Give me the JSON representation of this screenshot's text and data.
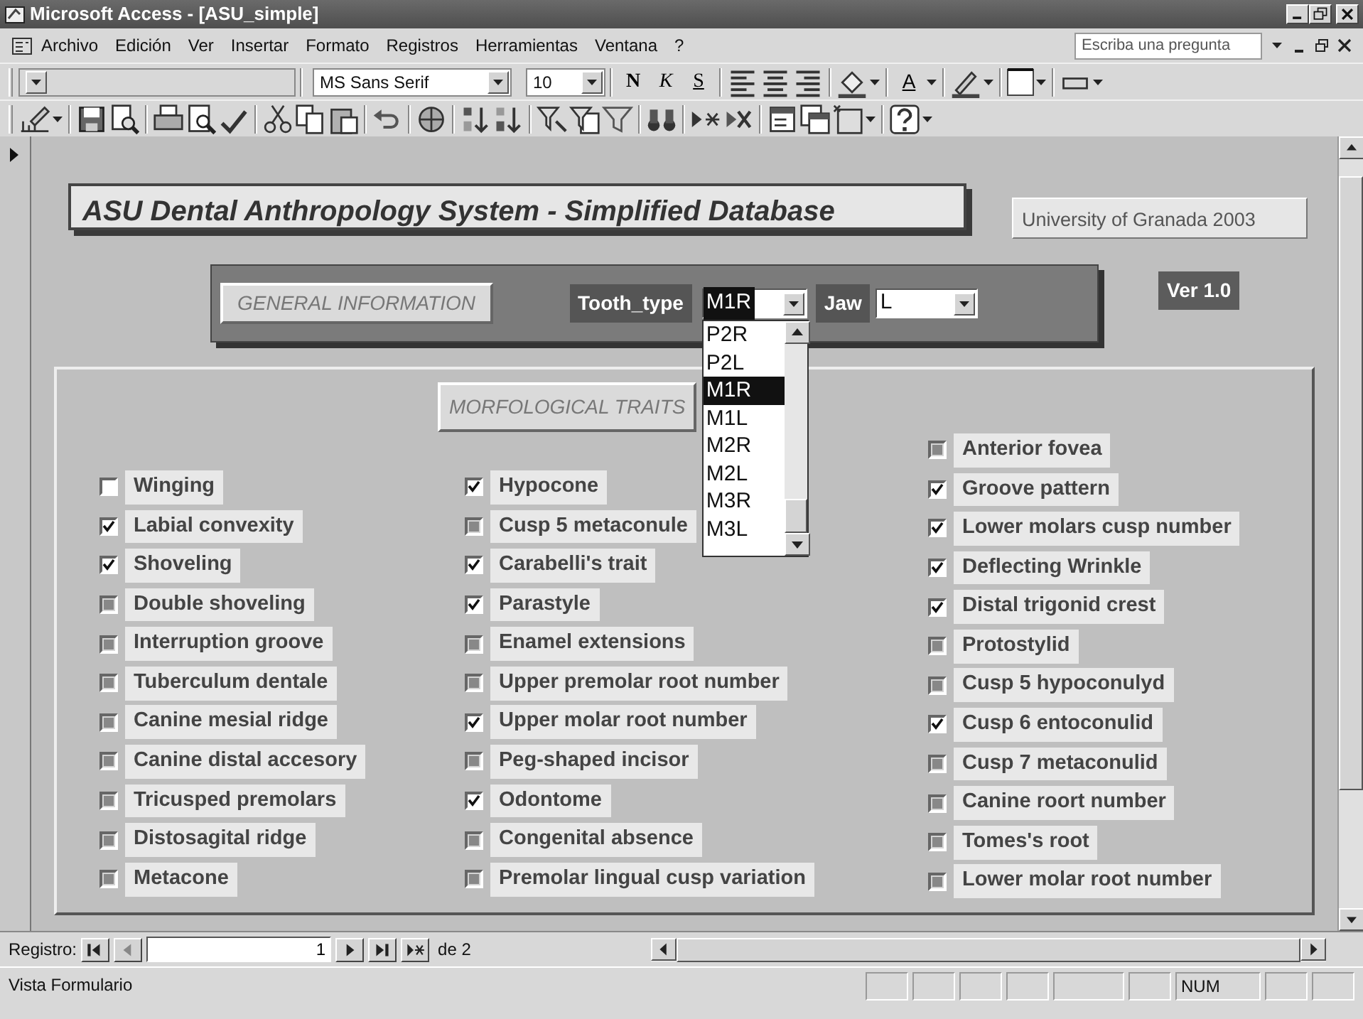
{
  "window": {
    "title": "Microsoft Access - [ASU_simple]"
  },
  "menu_bar": {
    "items": [
      "Archivo",
      "Edición",
      "Ver",
      "Insertar",
      "Formato",
      "Registros",
      "Herramientas",
      "Ventana",
      "?"
    ],
    "help_box": {
      "placeholder": "Escriba una pregunta"
    }
  },
  "format_toolbar": {
    "font": "MS Sans Serif",
    "size": "10",
    "style_buttons": [
      "N",
      "K",
      "S"
    ],
    "font_color_button": "A"
  },
  "form": {
    "title": "ASU Dental Anthropology System - Simplified Database",
    "credit": "University of Granada  2003",
    "general_panel": {
      "button": "GENERAL INFORMATION",
      "tooth_type": {
        "label": "Tooth_type",
        "value": "M1R",
        "expanded": true
      },
      "jaw": {
        "label": "Jaw",
        "value": "L"
      }
    },
    "version": "Ver 1.0",
    "tooth_list": [
      {
        "label": "P2R",
        "selected": false
      },
      {
        "label": "P2L",
        "selected": false
      },
      {
        "label": "M1R",
        "selected": true
      },
      {
        "label": "M1L",
        "selected": false
      },
      {
        "label": "M2R",
        "selected": false
      },
      {
        "label": "M2L",
        "selected": false
      },
      {
        "label": "M3R",
        "selected": false
      },
      {
        "label": "M3L",
        "selected": false
      }
    ],
    "traits": {
      "title": "MORFOLOGICAL TRAITS",
      "columns": [
        {
          "items": [
            {
              "label": "Winging",
              "checked": false,
              "greyed": false
            },
            {
              "label": "Labial convexity",
              "checked": true,
              "greyed": false
            },
            {
              "label": "Shoveling",
              "checked": true,
              "greyed": false
            },
            {
              "label": "Double shoveling",
              "checked": false,
              "greyed": true
            },
            {
              "label": "Interruption groove",
              "checked": false,
              "greyed": true
            },
            {
              "label": "Tuberculum dentale",
              "checked": false,
              "greyed": true
            },
            {
              "label": "Canine mesial ridge",
              "checked": false,
              "greyed": true
            },
            {
              "label": "Canine distal accesory",
              "checked": false,
              "greyed": true
            },
            {
              "label": "Tricusped premolars",
              "checked": false,
              "greyed": true
            },
            {
              "label": "Distosagital ridge",
              "checked": false,
              "greyed": true
            },
            {
              "label": "Metacone",
              "checked": false,
              "greyed": true
            }
          ]
        },
        {
          "items": [
            {
              "label": "Hypocone",
              "checked": true,
              "greyed": false
            },
            {
              "label": "Cusp 5 metaconule",
              "checked": false,
              "greyed": true
            },
            {
              "label": "Carabelli's trait",
              "checked": true,
              "greyed": false
            },
            {
              "label": "Parastyle",
              "checked": true,
              "greyed": false
            },
            {
              "label": "Enamel extensions",
              "checked": false,
              "greyed": true
            },
            {
              "label": "Upper premolar root number",
              "checked": false,
              "greyed": true
            },
            {
              "label": "Upper molar root number",
              "checked": true,
              "greyed": false
            },
            {
              "label": "Peg-shaped incisor",
              "checked": false,
              "greyed": true
            },
            {
              "label": "Odontome",
              "checked": true,
              "greyed": false
            },
            {
              "label": "Congenital absence",
              "checked": false,
              "greyed": true
            },
            {
              "label": "Premolar lingual cusp variation",
              "checked": false,
              "greyed": true
            }
          ]
        },
        {
          "items": [
            {
              "label": "Anterior fovea",
              "checked": false,
              "greyed": true
            },
            {
              "label": "Groove pattern",
              "checked": true,
              "greyed": false
            },
            {
              "label": "Lower molars cusp number",
              "checked": true,
              "greyed": false
            },
            {
              "label": "Deflecting Wrinkle",
              "checked": true,
              "greyed": false
            },
            {
              "label": "Distal trigonid crest",
              "checked": true,
              "greyed": false
            },
            {
              "label": "Protostylid",
              "checked": false,
              "greyed": true
            },
            {
              "label": "Cusp 5 hypoconulyd",
              "checked": false,
              "greyed": true
            },
            {
              "label": "Cusp 6 entoconulid",
              "checked": true,
              "greyed": false
            },
            {
              "label": "Cusp 7 metaconulid",
              "checked": false,
              "greyed": true
            },
            {
              "label": "Canine roort number",
              "checked": false,
              "greyed": true
            },
            {
              "label": "Tomes's root",
              "checked": false,
              "greyed": true
            },
            {
              "label": "Lower molar root number",
              "checked": false,
              "greyed": true
            }
          ]
        }
      ]
    }
  },
  "record_nav": {
    "label": "Registro:",
    "current": "1",
    "total": "de 2"
  },
  "status_bar": {
    "mode": "Vista Formulario",
    "indicator": "NUM"
  }
}
